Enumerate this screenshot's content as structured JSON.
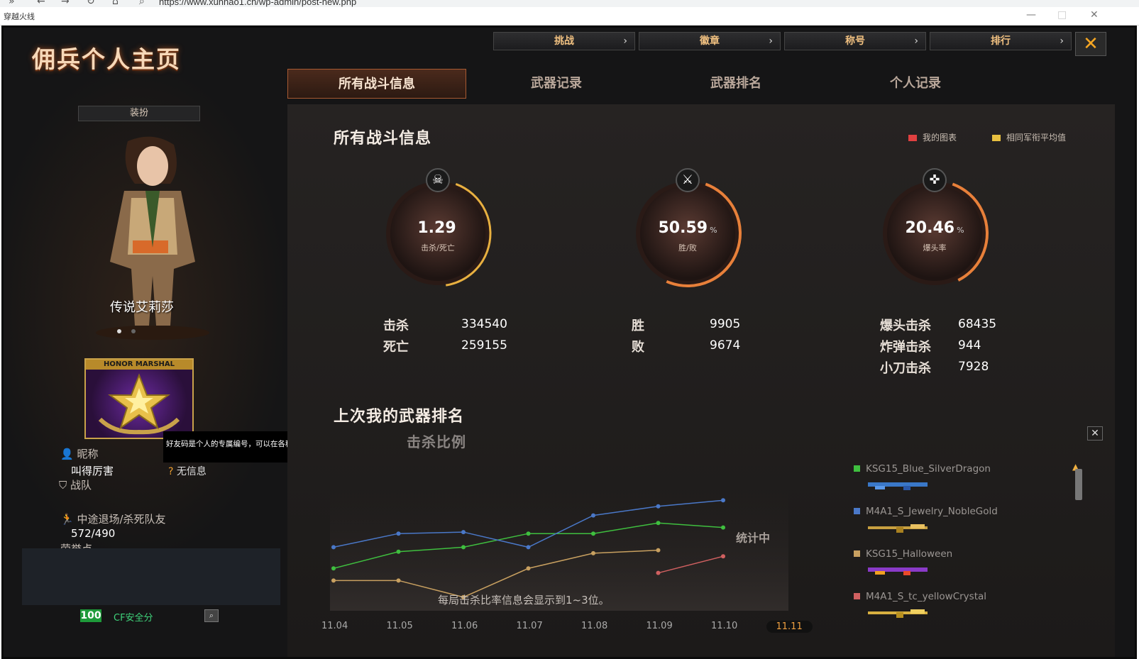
{
  "browser": {
    "url": "https://www.xunhao1.cn/wp-admin/post-new.php",
    "window_title": "穿越火线"
  },
  "game": {
    "page_title": "佣兵个人主页",
    "top_menu": [
      {
        "label": "挑战"
      },
      {
        "label": "徽章"
      },
      {
        "label": "称号"
      },
      {
        "label": "排行"
      }
    ],
    "close_glyph": "✕",
    "tabs": [
      {
        "label": "所有战斗信息",
        "active": true
      },
      {
        "label": "武器记录",
        "active": false
      },
      {
        "label": "武器排名",
        "active": false
      },
      {
        "label": "个人记录",
        "active": false
      }
    ],
    "left": {
      "dress_button": "装扮",
      "character_name": "传说艾莉莎",
      "badge_label": "HONOR MARSHAL",
      "tooltip": "好友码是个人的专属编号，可以在各种加好友场景中使用。",
      "nickname_label": "昵称",
      "nickname_value": "叫得厉害",
      "no_info": "无信息",
      "team_label": "战队",
      "quit_label": "中途退场/杀死队友",
      "quit_value": "572/490",
      "honor_label": "荣誉点",
      "score": "100",
      "cf_safe": "CF安全分"
    },
    "main": {
      "section_title": "所有战斗信息",
      "legend_mine": "我的图表",
      "legend_avg": "相同军衔平均值",
      "legend_mine_color": "#e04040",
      "legend_avg_color": "#e8c040",
      "rings": [
        {
          "value": "1.29",
          "unit": "",
          "sub": "击杀/死亡",
          "icon": "skull-icon",
          "glyph": "☠",
          "progress": 0.42
        },
        {
          "value": "50.59",
          "unit": "%",
          "sub": "胜/败",
          "icon": "crossed-guns-icon",
          "glyph": "⚔",
          "progress": 0.51
        },
        {
          "value": "20.46",
          "unit": "%",
          "sub": "爆头率",
          "icon": "sniper-icon",
          "glyph": "✜",
          "progress": 0.37
        }
      ],
      "stats_kd": [
        {
          "label": "击杀",
          "value": "334540"
        },
        {
          "label": "死亡",
          "value": "259155"
        }
      ],
      "stats_wl": [
        {
          "label": "胜",
          "value": "9905"
        },
        {
          "label": "败",
          "value": "9674"
        }
      ],
      "stats_special": [
        {
          "label": "爆头击杀",
          "value": "68435"
        },
        {
          "label": "炸弹击杀",
          "value": "944"
        },
        {
          "label": "小刀击杀",
          "value": "7928"
        }
      ],
      "weapon_rank_title": "上次我的武器排名",
      "kill_ratio_title": "击杀比例",
      "stat_in_progress": "统计中",
      "chart_note": "每局击杀比率信息会显示到1~3位。",
      "weapons": [
        {
          "name": "KSG15_Blue_SilverDragon",
          "color": "#3fbf3f"
        },
        {
          "name": "M4A1_S_Jewelry_NobleGold",
          "color": "#4a78c8"
        },
        {
          "name": "KSG15_Halloween",
          "color": "#c8a060"
        },
        {
          "name": "M4A1_S_tc_yellowCrystal",
          "color": "#d06060"
        }
      ]
    }
  },
  "chart_data": {
    "type": "line",
    "title": "击杀比例",
    "x": [
      "11.04",
      "11.05",
      "11.06",
      "11.07",
      "11.08",
      "11.09",
      "11.10",
      "11.11"
    ],
    "current_x": "11.11",
    "series": [
      {
        "name": "KSG15_Blue_SilverDragon",
        "color": "#3fbf3f",
        "values": [
          0.13,
          0.24,
          0.27,
          0.36,
          0.36,
          0.43,
          0.4,
          null
        ]
      },
      {
        "name": "M4A1_S_Jewelry_NobleGold",
        "color": "#4a78c8",
        "values": [
          0.27,
          0.36,
          0.37,
          0.27,
          0.48,
          0.54,
          0.58,
          null
        ]
      },
      {
        "name": "KSG15_Halloween",
        "color": "#c8a060",
        "values": [
          0.05,
          0.05,
          -0.06,
          0.13,
          0.23,
          0.25,
          null,
          null
        ]
      },
      {
        "name": "M4A1_S_tc_yellowCrystal",
        "color": "#d06060",
        "values": [
          null,
          null,
          null,
          null,
          null,
          0.1,
          0.21,
          null
        ]
      }
    ],
    "ylim": [
      -0.15,
      0.75
    ],
    "grid": false
  }
}
